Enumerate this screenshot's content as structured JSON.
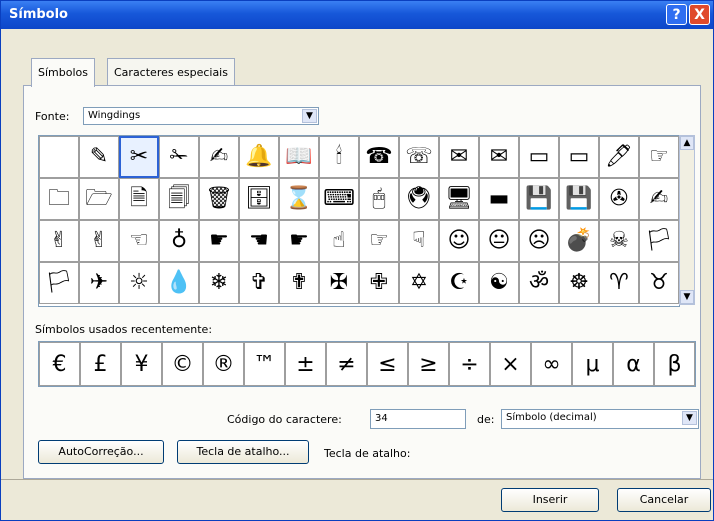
{
  "window": {
    "title": "Símbolo",
    "help_label": "?",
    "close_label": "X"
  },
  "tabs": [
    {
      "label": "Símbolos"
    },
    {
      "label": "Caracteres especiais"
    }
  ],
  "font": {
    "label": "Fonte:",
    "value": "Wingdings"
  },
  "symbol_grid": [
    [
      "",
      "✎",
      "✂",
      "✁",
      "✍",
      "🔔",
      "📖",
      "🕯",
      "☎",
      "☏",
      "✉",
      "✉",
      "▭",
      "▭",
      "🖊",
      "☞"
    ],
    [
      "🗀",
      "🗁",
      "🗎",
      "🗐",
      "🗑",
      "🗄",
      "⌛",
      "⌨",
      "🖱",
      "🖲",
      "🖥",
      "▬",
      "💾",
      "💾",
      "✇",
      "✍"
    ],
    [
      "✌",
      "✌",
      "☜",
      "♁",
      "☛",
      "☚",
      "☛",
      "☝",
      "☞",
      "☟",
      "☺",
      "😐",
      "☹",
      "💣",
      "☠",
      "🏳"
    ],
    [
      "🏳",
      "✈",
      "☼",
      "💧",
      "❄",
      "✞",
      "✟",
      "✠",
      "✙",
      "✡",
      "☪",
      "☯",
      "ॐ",
      "☸",
      "♈",
      "♉"
    ]
  ],
  "recent_label": "Símbolos usados recentemente:",
  "recent_symbols": [
    "€",
    "£",
    "¥",
    "©",
    "®",
    "™",
    "±",
    "≠",
    "≤",
    "≥",
    "÷",
    "×",
    "∞",
    "μ",
    "α",
    "β"
  ],
  "char_code": {
    "label": "Código do caractere:",
    "value": "34",
    "from_label": "de:",
    "from_value": "Símbolo (decimal)"
  },
  "buttons": {
    "autocorrect": "AutoCorreção...",
    "shortcut_key": "Tecla de atalho...",
    "shortcut_label": "Tecla de atalho:",
    "insert": "Inserir",
    "cancel": "Cancelar"
  }
}
